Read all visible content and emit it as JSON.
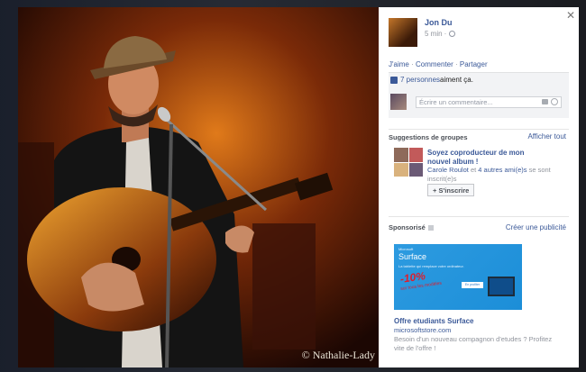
{
  "photo": {
    "credit": "© Nathalie-Lady"
  },
  "post": {
    "author": "Jon Du",
    "time": "5 min",
    "actions": [
      "J'aime",
      "Commenter",
      "Partager"
    ],
    "like_count": "7 personnes",
    "like_suffix": " aiment ça.",
    "comment_placeholder": "Écrire un commentaire..."
  },
  "groups": {
    "heading": "Suggestions de groupes",
    "see_all": "Afficher tout",
    "title": "Soyez coproducteur de mon nouvel album !",
    "member_name": "Carole Roulot",
    "member_and": " et ",
    "member_others": "4 autres ami(e)s",
    "member_suffix": " se sont inscrit(e)s",
    "join_label": "+ S'inscrire"
  },
  "sponsored": {
    "heading": "Sponsorisé",
    "create_ad": "Créer une publicité",
    "ad": {
      "brand": "Microsoft",
      "product": "Surface",
      "tagline": "La tablette qui remplace votre ordinateur.",
      "promo": "-10%",
      "promo_sub": "sur tous les modèles",
      "cta": "En profiter",
      "title": "Offre etudiants Surface",
      "domain": "microsoftstore.com",
      "description": "Besoin d'un nouveau compagnon d'etudes ? Profitez vite de l'offre !"
    }
  },
  "icons": {
    "close": "close-icon",
    "globe": "globe-icon",
    "like": "thumbs-up-icon",
    "camera": "camera-icon",
    "emoji": "smiley-icon",
    "sponsored": "sponsored-icon"
  },
  "colors": {
    "link": "#3b5998",
    "muted": "#90949c",
    "ad_background": "#2d9be0",
    "promo": "#e11c2b"
  }
}
